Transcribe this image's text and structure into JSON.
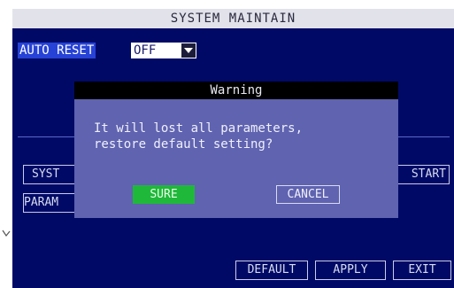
{
  "window": {
    "title": "SYSTEM MAINTAIN"
  },
  "settings": {
    "auto_reset_label": "AUTO RESET",
    "auto_reset_value": "OFF"
  },
  "side_buttons": {
    "system_label": "SYST",
    "parameter_label": "PARAM",
    "start_label": "START"
  },
  "footer": {
    "default_label": "DEFAULT",
    "apply_label": "APPLY",
    "exit_label": "EXIT"
  },
  "dialog": {
    "title": "Warning",
    "message_line1": "It will lost all parameters,",
    "message_line2": "restore default setting?",
    "sure_label": "SURE",
    "cancel_label": "CANCEL"
  },
  "colors": {
    "screen_background": "#000a66",
    "title_bar": "#e2e2ea",
    "dialog_background": "#5f63b0",
    "dialog_title_bar": "#000000",
    "focus_highlight": "#2742d6",
    "confirm_button": "#1fb83a"
  },
  "icons": {
    "dropdown": "dropdown-arrow-icon"
  }
}
